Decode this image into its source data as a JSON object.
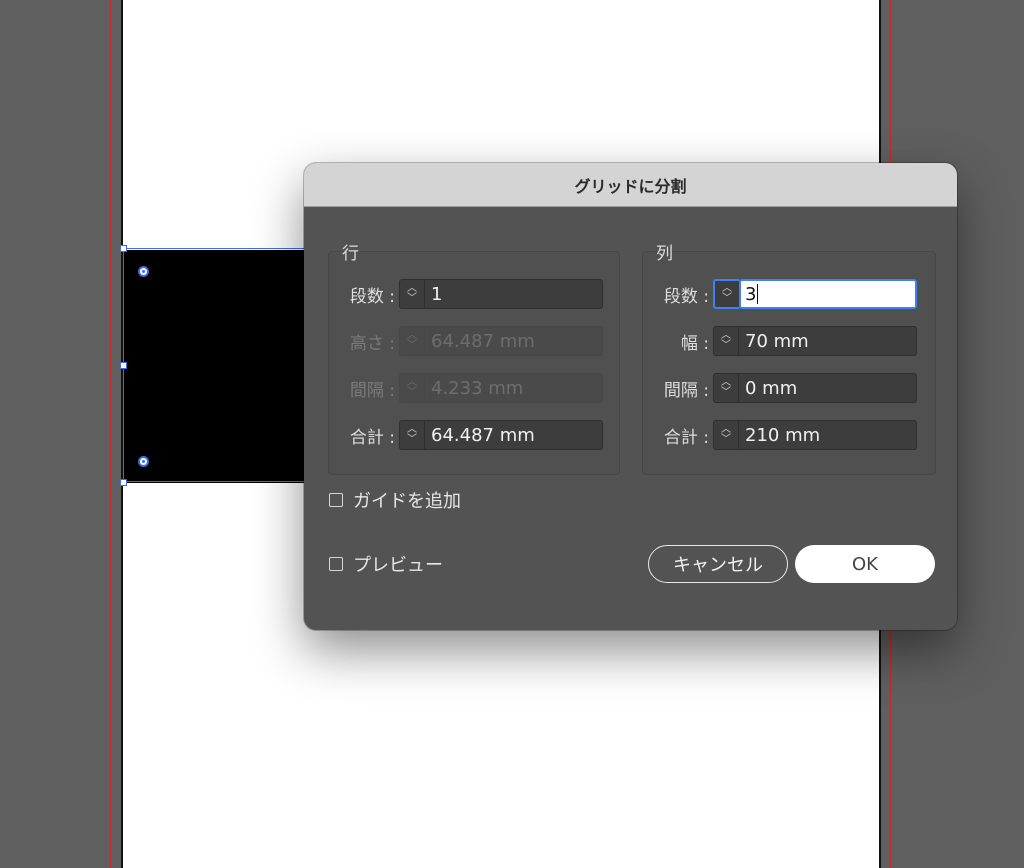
{
  "dialog": {
    "title": "グリッドに分割",
    "rows_group": {
      "title": "行",
      "count": {
        "label": "段数 :",
        "value": "1"
      },
      "height": {
        "label": "高さ :",
        "value": "64.487 mm"
      },
      "gutter": {
        "label": "間隔 :",
        "value": "4.233 mm"
      },
      "total": {
        "label": "合計 :",
        "value": "64.487 mm"
      }
    },
    "columns_group": {
      "title": "列",
      "count": {
        "label": "段数 :",
        "value": "3"
      },
      "width": {
        "label": "幅 :",
        "value": "70 mm"
      },
      "gutter": {
        "label": "間隔 :",
        "value": "0 mm"
      },
      "total": {
        "label": "合計 :",
        "value": "210 mm"
      }
    },
    "add_guides_label": "ガイドを追加",
    "preview_label": "プレビュー",
    "cancel_label": "キャンセル",
    "ok_label": "OK"
  },
  "icons": {
    "stepper": "updown-chevron-icon",
    "checkbox": "checkbox-unchecked-icon"
  },
  "colors": {
    "selection": "#3b6ee6",
    "focus": "#3d82f0",
    "guide": "#c62c2c",
    "dialog_bg": "#535353",
    "pasteboard": "#5f5f5f"
  }
}
